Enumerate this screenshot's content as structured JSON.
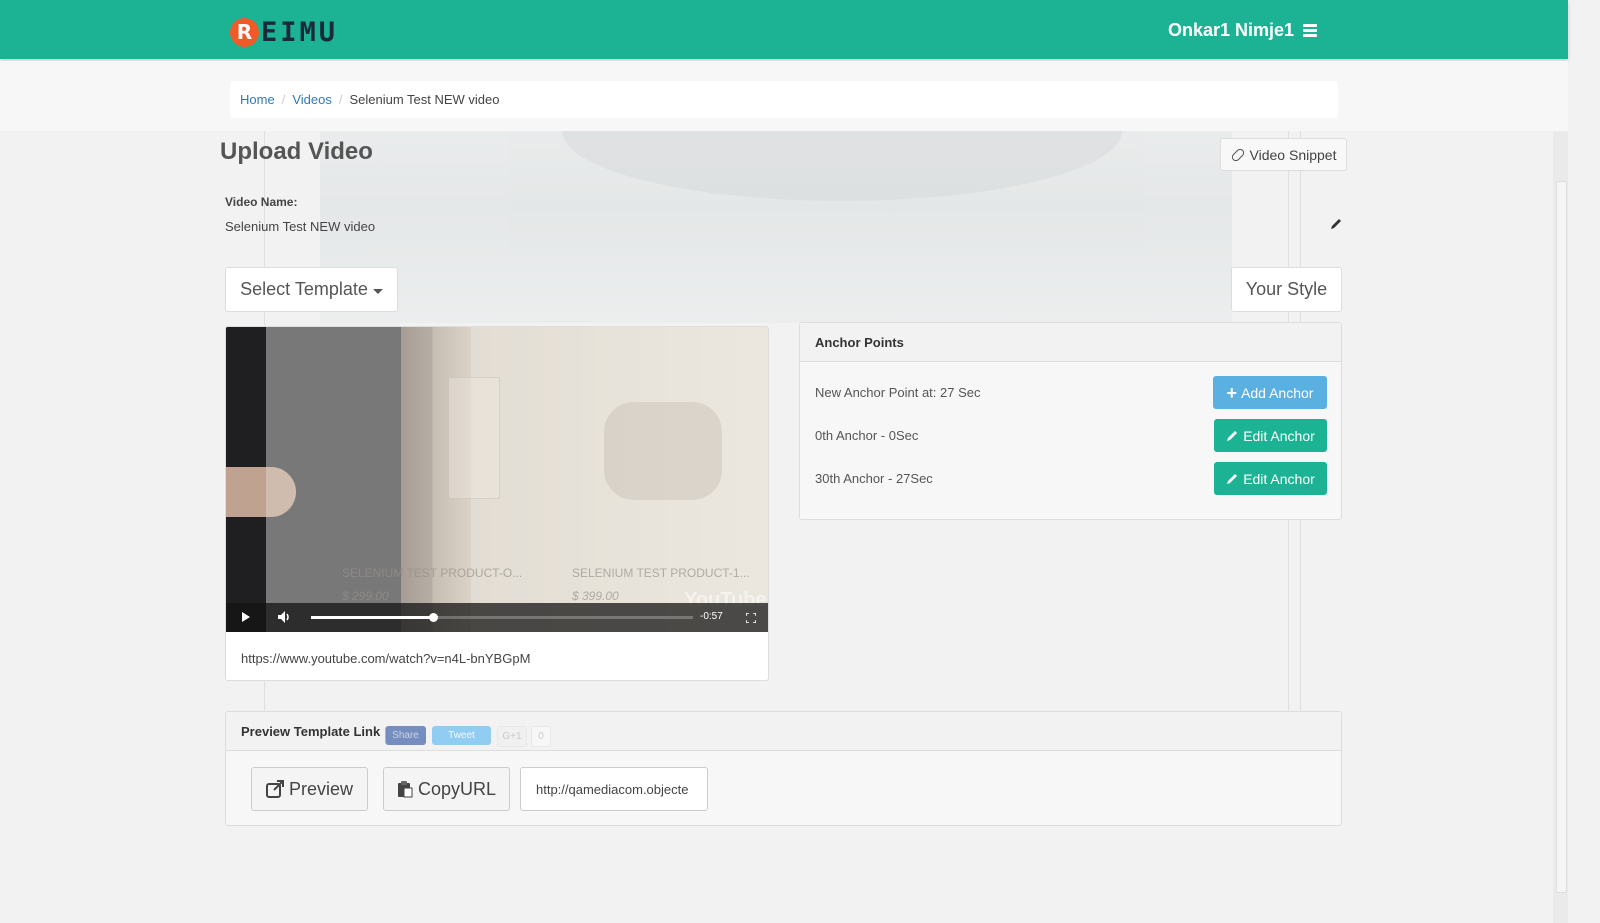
{
  "header": {
    "logo_initial": "R",
    "logo_text": "EIMU",
    "user_name": "Onkar1 Nimje1"
  },
  "breadcrumb": {
    "items": [
      "Home",
      "Videos"
    ],
    "current": "Selenium Test NEW video"
  },
  "page": {
    "title": "Upload Video",
    "video_snippet_label": "Video Snippet",
    "video_name_label": "Video Name:",
    "video_name_value": "Selenium Test NEW video",
    "select_template_label": "Select Template",
    "your_style_label": "Your Style"
  },
  "video": {
    "url": "https://www.youtube.com/watch?v=n4L-bnYBGpM",
    "time_remaining": "-0:57",
    "progress": 0.32,
    "watermark": "YouTube",
    "products": [
      {
        "name": "SELENIUM TEST PRODUCT-O...",
        "price": "$ 299.00"
      },
      {
        "name": "SELENIUM TEST PRODUCT-1...",
        "price": "$ 399.00"
      }
    ]
  },
  "anchors": {
    "title": "Anchor Points",
    "new_anchor_text": "New Anchor Point at: 27 Sec",
    "add_label": "Add Anchor",
    "rows": [
      {
        "text": "0th Anchor - 0Sec",
        "button": "Edit Anchor"
      },
      {
        "text": "30th Anchor - 27Sec",
        "button": "Edit Anchor"
      }
    ]
  },
  "preview": {
    "title": "Preview Template Link",
    "preview_label": "Preview",
    "copy_label": "CopyURL",
    "url_value": "http://qamediacom.objecte",
    "social": [
      "Share",
      "Tweet",
      "G+1",
      "0"
    ]
  },
  "colors": {
    "brand": "#1bb394",
    "add_button": "#5ab0e0",
    "logo_badge": "#f05a28"
  }
}
